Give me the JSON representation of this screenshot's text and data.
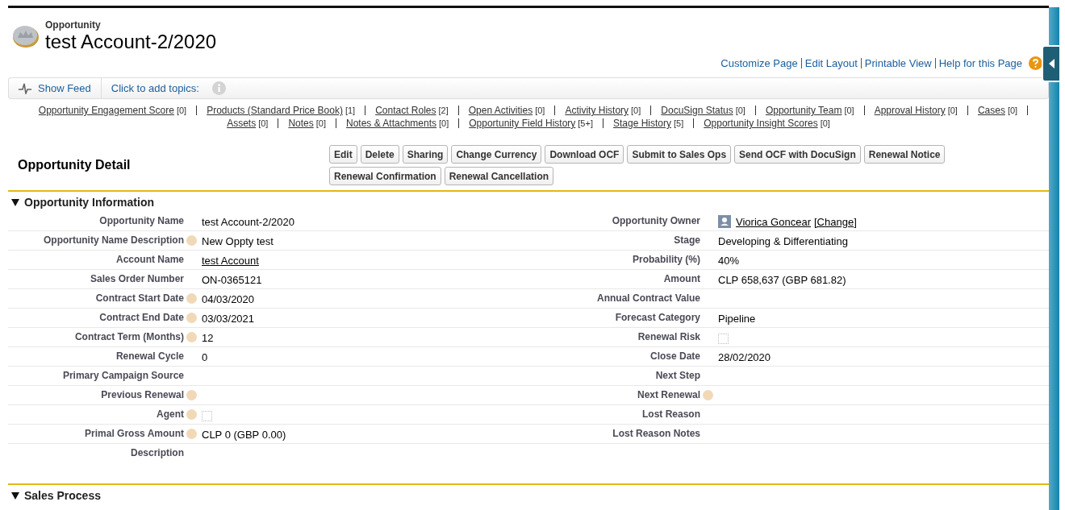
{
  "header": {
    "object_type": "Opportunity",
    "title": "test Account-2/2020"
  },
  "page_links": [
    "Customize Page",
    "Edit Layout",
    "Printable View",
    "Help for this Page"
  ],
  "feed_bar": {
    "show_feed": "Show Feed",
    "topics": "Click to add topics:"
  },
  "related_lists": [
    {
      "links": [
        {
          "label": "Opportunity Engagement Score",
          "count": "[0]"
        },
        {
          "label": "Products (Standard Price Book)",
          "count": "[1]"
        },
        {
          "label": "Contact Roles",
          "count": "[2]"
        },
        {
          "label": "Open Activities",
          "count": "[0]"
        },
        {
          "label": "Activity History",
          "count": "[0]"
        },
        {
          "label": "DocuSign Status",
          "count": "[0]"
        },
        {
          "label": "Opportunity Team",
          "count": "[0]"
        },
        {
          "label": "Approval History",
          "count": "[0]"
        },
        {
          "label": "Cases",
          "count": "[0]"
        }
      ]
    },
    {
      "links": [
        {
          "label": "Assets",
          "count": "[0]"
        },
        {
          "label": "Notes",
          "count": "[0]"
        },
        {
          "label": "Notes & Attachments",
          "count": "[0]"
        },
        {
          "label": "Opportunity Field History",
          "count": "[5+]"
        },
        {
          "label": "Stage History",
          "count": "[5]"
        },
        {
          "label": "Opportunity Insight Scores",
          "count": "[0]"
        }
      ]
    }
  ],
  "detail": {
    "title": "Opportunity Detail",
    "buttons": [
      "Edit",
      "Delete",
      "Sharing",
      "Change Currency",
      "Download OCF",
      "Submit to Sales Ops",
      "Send OCF with DocuSign",
      "Renewal Notice",
      "Renewal Confirmation",
      "Renewal Cancellation"
    ]
  },
  "sections": [
    {
      "title": "Opportunity Information",
      "expanded": true,
      "rows": [
        {
          "left": {
            "label": "Opportunity Name",
            "help": false,
            "kind": "text",
            "value": "test Account-2/2020"
          },
          "right": {
            "label": "Opportunity Owner",
            "help": false,
            "kind": "user",
            "value": "Viorica Goncear",
            "action": "[Change]"
          }
        },
        {
          "left": {
            "label": "Opportunity Name Description",
            "help": true,
            "kind": "text",
            "value": "New Oppty test"
          },
          "right": {
            "label": "Stage",
            "help": false,
            "kind": "text",
            "value": "Developing & Differentiating"
          }
        },
        {
          "left": {
            "label": "Account Name",
            "help": false,
            "kind": "link",
            "value": "test Account"
          },
          "right": {
            "label": "Probability (%)",
            "help": false,
            "kind": "text",
            "value": "40%"
          }
        },
        {
          "left": {
            "label": "Sales Order Number",
            "help": false,
            "kind": "text",
            "value": "ON-0365121"
          },
          "right": {
            "label": "Amount",
            "help": false,
            "kind": "text",
            "value": "CLP 658,637 (GBP 681.82)"
          }
        },
        {
          "left": {
            "label": "Contract Start Date",
            "help": true,
            "kind": "text",
            "value": "04/03/2020"
          },
          "right": {
            "label": "Annual Contract Value",
            "help": false,
            "kind": "text"
          }
        },
        {
          "left": {
            "label": "Contract End Date",
            "help": true,
            "kind": "text",
            "value": "03/03/2021"
          },
          "right": {
            "label": "Forecast Category",
            "help": false,
            "kind": "text",
            "value": "Pipeline"
          }
        },
        {
          "left": {
            "label": "Contract Term (Months)",
            "help": true,
            "kind": "text",
            "value": "12"
          },
          "right": {
            "label": "Renewal Risk",
            "help": false,
            "kind": "checkbox",
            "checked": false
          }
        },
        {
          "left": {
            "label": "Renewal Cycle",
            "help": false,
            "kind": "text",
            "value": "0"
          },
          "right": {
            "label": "Close Date",
            "help": false,
            "kind": "text",
            "value": "28/02/2020"
          }
        },
        {
          "left": {
            "label": "Primary Campaign Source",
            "help": false,
            "kind": "text"
          },
          "right": {
            "label": "Next Step",
            "help": false,
            "kind": "text"
          }
        },
        {
          "left": {
            "label": "Previous Renewal",
            "help": true,
            "kind": "text"
          },
          "right": {
            "label": "Next Renewal",
            "help": true,
            "kind": "text"
          }
        },
        {
          "left": {
            "label": "Agent",
            "help": true,
            "kind": "checkbox",
            "checked": false
          },
          "right": {
            "label": "Lost Reason",
            "help": false,
            "kind": "text"
          }
        },
        {
          "left": {
            "label": "Primal Gross Amount",
            "help": true,
            "kind": "text",
            "value": "CLP 0 (GBP 0.00)"
          },
          "right": {
            "label": "Lost Reason Notes",
            "help": false,
            "kind": "text"
          }
        },
        {
          "left": {
            "label": "Description",
            "help": false,
            "kind": "text"
          }
        }
      ]
    },
    {
      "title": "Sales Process",
      "expanded": true
    }
  ]
}
